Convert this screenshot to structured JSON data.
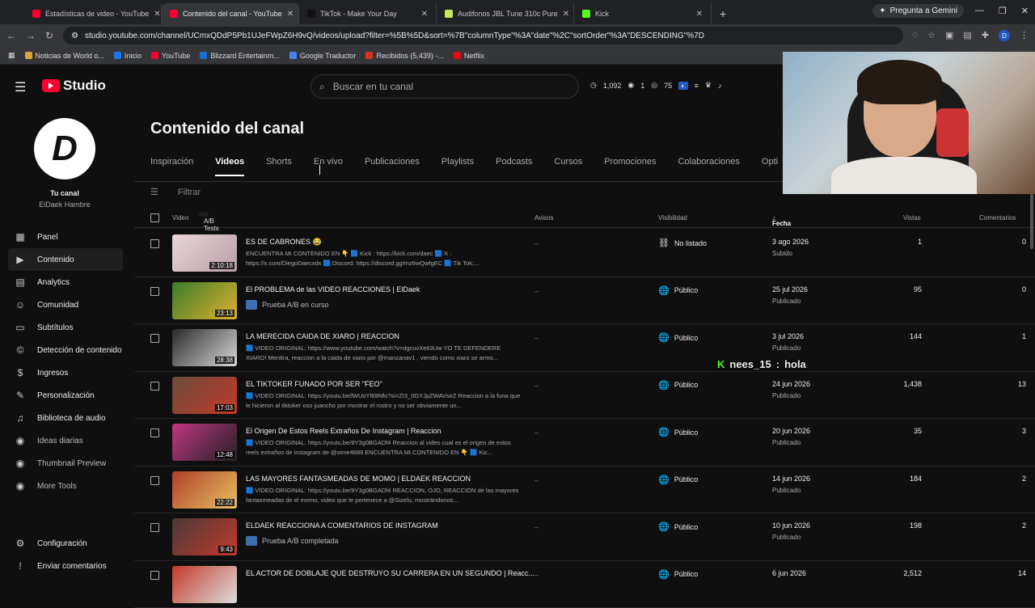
{
  "browser": {
    "tabs": [
      {
        "label": "Estadísticas de video - YouTube",
        "color": "#ff0033"
      },
      {
        "label": "Contenido del canal - YouTube",
        "color": "#ff0033",
        "active": true
      },
      {
        "label": "TikTok - Make Your Day",
        "color": "#111111"
      },
      {
        "label": "Audifonos JBL Tune 310c Pure",
        "color": "#c8e85a"
      },
      {
        "label": "Kick",
        "color": "#53fc18"
      }
    ],
    "gemini_label": "Pregunta a Gemini",
    "url": "studio.youtube.com/channel/UCmxQDdP5Pb1UJeFWpZ6H9vQ/videos/upload?filter=%5B%5D&sort=%7B\"columnType\"%3A\"date\"%2C\"sortOrder\"%3A\"DESCENDING\"%7D",
    "profile_initial": "D",
    "bookmarks": [
      {
        "label": "Noticias de World o...",
        "color": "#e2a33a"
      },
      {
        "label": "Inicio",
        "color": "#1877f2"
      },
      {
        "label": "YouTube",
        "color": "#ff0033"
      },
      {
        "label": "Blizzard Entertainm...",
        "color": "#1a6fd1"
      },
      {
        "label": "Google Traductor",
        "color": "#4285f4"
      },
      {
        "label": "Recibidos (5,439) -...",
        "color": "#d93025"
      },
      {
        "label": "Netflix",
        "color": "#e50914"
      }
    ]
  },
  "header": {
    "logo_text": "Studio",
    "search_placeholder": "Buscar en tu canal",
    "stats": [
      "1,092",
      "1",
      "75"
    ]
  },
  "sidebar": {
    "channel_initial": "D",
    "your_channel": "Tu canal",
    "channel_name": "ElDaek Hambre",
    "items": [
      {
        "label": "Panel",
        "icon": "▦"
      },
      {
        "label": "Contenido",
        "icon": "▶",
        "selected": true
      },
      {
        "label": "Analytics",
        "icon": "▤"
      },
      {
        "label": "Comunidad",
        "icon": "☺"
      },
      {
        "label": "Subtítulos",
        "icon": "▭"
      },
      {
        "label": "Detección de contenido",
        "icon": "©"
      },
      {
        "label": "Ingresos",
        "icon": "$"
      },
      {
        "label": "Personalización",
        "icon": "✎"
      },
      {
        "label": "Biblioteca de audio",
        "icon": "♫"
      },
      {
        "label": "Ideas diarias",
        "icon": "◉"
      },
      {
        "label": "Thumbnail Preview",
        "icon": "◉"
      },
      {
        "label": "More Tools",
        "icon": "◉"
      }
    ],
    "bottom": [
      {
        "label": "Configuración",
        "icon": "⚙"
      },
      {
        "label": "Enviar comentarios",
        "icon": "!"
      }
    ]
  },
  "main": {
    "title": "Contenido del canal",
    "tabs": [
      "Inspiración",
      "Videos",
      "Shorts",
      "En vivo",
      "Publicaciones",
      "Playlists",
      "Podcasts",
      "Cursos",
      "Promociones",
      "Colaboraciones",
      "Opti"
    ],
    "active_tab": "Videos",
    "filter_label": "Filtrar",
    "columns": {
      "video": "Video",
      "ab_tests": "A/B Tests",
      "notices": "Avisos",
      "visibility": "Visibilidad",
      "date": "Fecha",
      "views": "Vistas",
      "comments": "Comentarios"
    },
    "rows": [
      {
        "title": "ES DE CABRONES 😂",
        "desc": "ENCUENTRA MI CONTENIDO EN 👇 🟦 Kick : https://kick.com/daec 🟦 X : https://x.com/DiegoDaecxdx 🟦 Discord: https://discord.gg/mz6wQwfgEC 🟦 Tik Tok:...",
        "duration": "2:10:18",
        "notices": "–",
        "visibility": "No listado",
        "vis_icon": "⛓",
        "date": "3 ago 2026",
        "date_sub": "Subido",
        "views": "1",
        "comments": "0",
        "thumb": [
          "#e9d5d8",
          "#b89fa6"
        ]
      },
      {
        "title": "El PROBLEMA de las VIDEO REACCIONES | ElDaek",
        "ab": "Prueba A/B en curso",
        "duration": "23:13",
        "notices": "–",
        "visibility": "Público",
        "vis_icon": "🌐",
        "date": "25 jul 2026",
        "date_sub": "Publicado",
        "views": "95",
        "comments": "0",
        "thumb": [
          "#3a7d2a",
          "#e0b030"
        ]
      },
      {
        "title": "LA MERECIDA CAIDA DE XIARO | REACCION",
        "desc": "🟦 VIDEO ORIGINAL: https://www.youtube.com/watch?v=dgcuvXe63Uw YO TE DEFENDERE XIARO! Mentira, reaccion a la caida de xiaro por @manzanav1 , viendo como xiaro se armo...",
        "duration": "28:38",
        "notices": "–",
        "visibility": "Público",
        "vis_icon": "🌐",
        "date": "3 jul 2026",
        "date_sub": "Publicado",
        "views": "144",
        "comments": "1",
        "thumb": [
          "#2a2a2a",
          "#d8d8d8"
        ]
      },
      {
        "title": "EL TIKTOKER FUNADO POR SER \"FEO\"",
        "desc": "🟦 VIDEO ORIGINAL: https://youtu.be/lWUoYl69Nfo?si=ZI3_0GYJpZWAVseZ Reaccion a la funa que le hicieron al tiktoker oso juancho por mostrar el rostro y no ser obviamente un...",
        "duration": "17:03",
        "notices": "–",
        "visibility": "Público",
        "vis_icon": "🌐",
        "date": "24 jun 2026",
        "date_sub": "Publicado",
        "views": "1,438",
        "comments": "13",
        "thumb": [
          "#6b4b3a",
          "#c23a2a"
        ]
      },
      {
        "title": "El Origen De Estos Reels Extraños De Instagram | Reaccion",
        "desc": "🟦 VIDEO ORIGINAL: https://youtu.be/9Y3g0BGADf4 Reaccion al video cual es el origen de estos reels extraños de instagram de @xime4689 ENCUENTRA MI CONTENIDO EN 👇 🟦 Kic...",
        "duration": "12:48",
        "notices": "–",
        "visibility": "Público",
        "vis_icon": "🌐",
        "date": "20 jun 2026",
        "date_sub": "Publicado",
        "views": "35",
        "comments": "3",
        "thumb": [
          "#c13584",
          "#222222"
        ]
      },
      {
        "title": "LAS MAYORES FANTASMEADAS DE MOMO | ELDAEK REACCION",
        "desc": "🟦 VIDEO ORIGINAL: https://youtu.be/9Y3g0BGADf4 REACCION, OJO, REACCION de las mayores fantasmeadas de el momo, video que le pertenece a @Sizelu, mostrándonos...",
        "duration": "22:22",
        "notices": "–",
        "visibility": "Público",
        "vis_icon": "🌐",
        "date": "14 jun 2026",
        "date_sub": "Publicado",
        "views": "184",
        "comments": "2",
        "thumb": [
          "#b0402a",
          "#e8c060"
        ]
      },
      {
        "title": "ELDAEK REACCIONA A COMENTARIOS DE INSTAGRAM",
        "ab": "Prueba A/B completada",
        "duration": "9:43",
        "notices": "–",
        "visibility": "Público",
        "vis_icon": "🌐",
        "date": "10 jun 2026",
        "date_sub": "Publicado",
        "views": "198",
        "comments": "2",
        "thumb": [
          "#4a3a3a",
          "#c23a2a"
        ]
      },
      {
        "title": "EL ACTOR DE DOBLAJE QUE DESTRUYO SU CARRERA EN UN SEGUNDO | Reacc...",
        "duration": "",
        "notices": "–",
        "visibility": "Público",
        "vis_icon": "🌐",
        "date": "6 jun 2026",
        "date_sub": "",
        "views": "2,512",
        "comments": "14",
        "thumb": [
          "#c23a2a",
          "#dddddd"
        ]
      }
    ]
  },
  "overlay": {
    "chat_user": "nees_15",
    "chat_text": "hola"
  }
}
